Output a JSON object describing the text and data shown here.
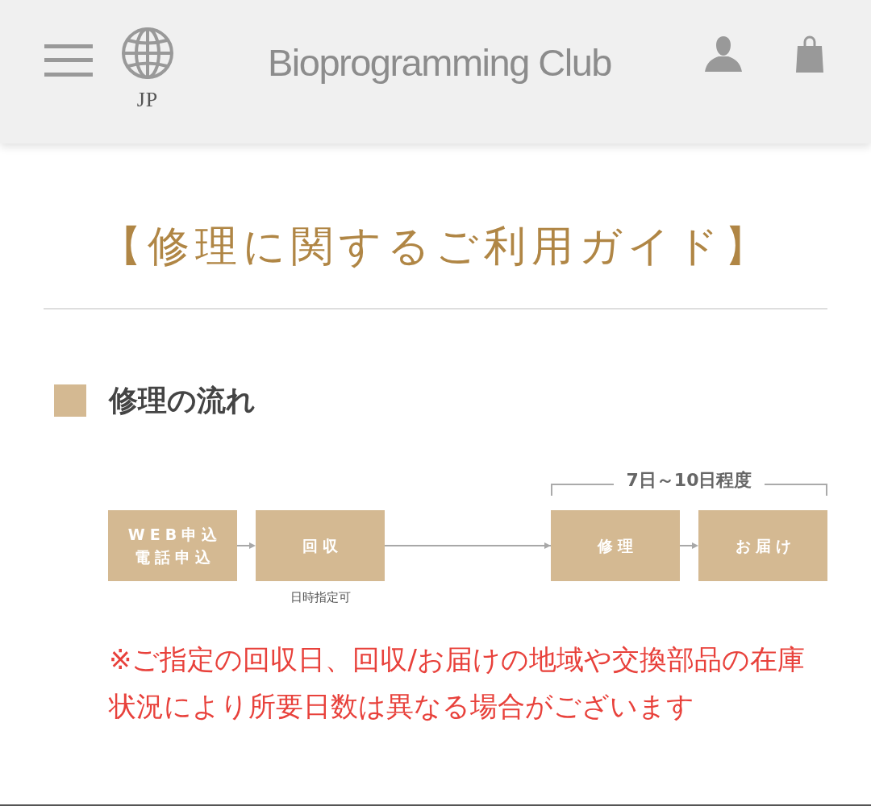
{
  "header": {
    "language": "JP",
    "title": "Bioprogramming Club"
  },
  "page_title": "【修理に関するご利用ガイド】",
  "section": {
    "title": "修理の流れ",
    "flow": {
      "stages": [
        {
          "steps": [
            {
              "lines": [
                "WEB申込",
                "電話申込"
              ]
            },
            {
              "lines": [
                "回収"
              ],
              "caption": "日時指定可"
            }
          ]
        },
        {
          "period": "7日～10日程度",
          "steps": [
            {
              "lines": [
                "修理"
              ]
            },
            {
              "lines": [
                "お届け"
              ]
            }
          ]
        }
      ]
    }
  },
  "note": "※ご指定の回収日、回収/お届けの地域や交換部品の在庫状況により所要日数は異なる場合がございます"
}
